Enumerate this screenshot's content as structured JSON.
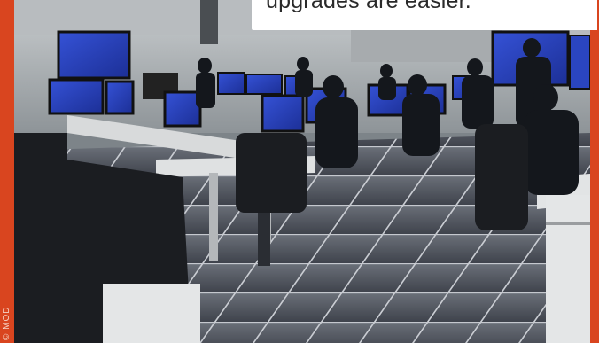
{
  "caption": {
    "text": "upgrades are easier."
  },
  "photo": {
    "credit": "© MOD",
    "subject": "naval-operations-room"
  },
  "colors": {
    "frame": "#d9451f",
    "caption_background": "#ffffff",
    "caption_text": "#2a2a2a",
    "screen_glow": "#2f49c8"
  }
}
